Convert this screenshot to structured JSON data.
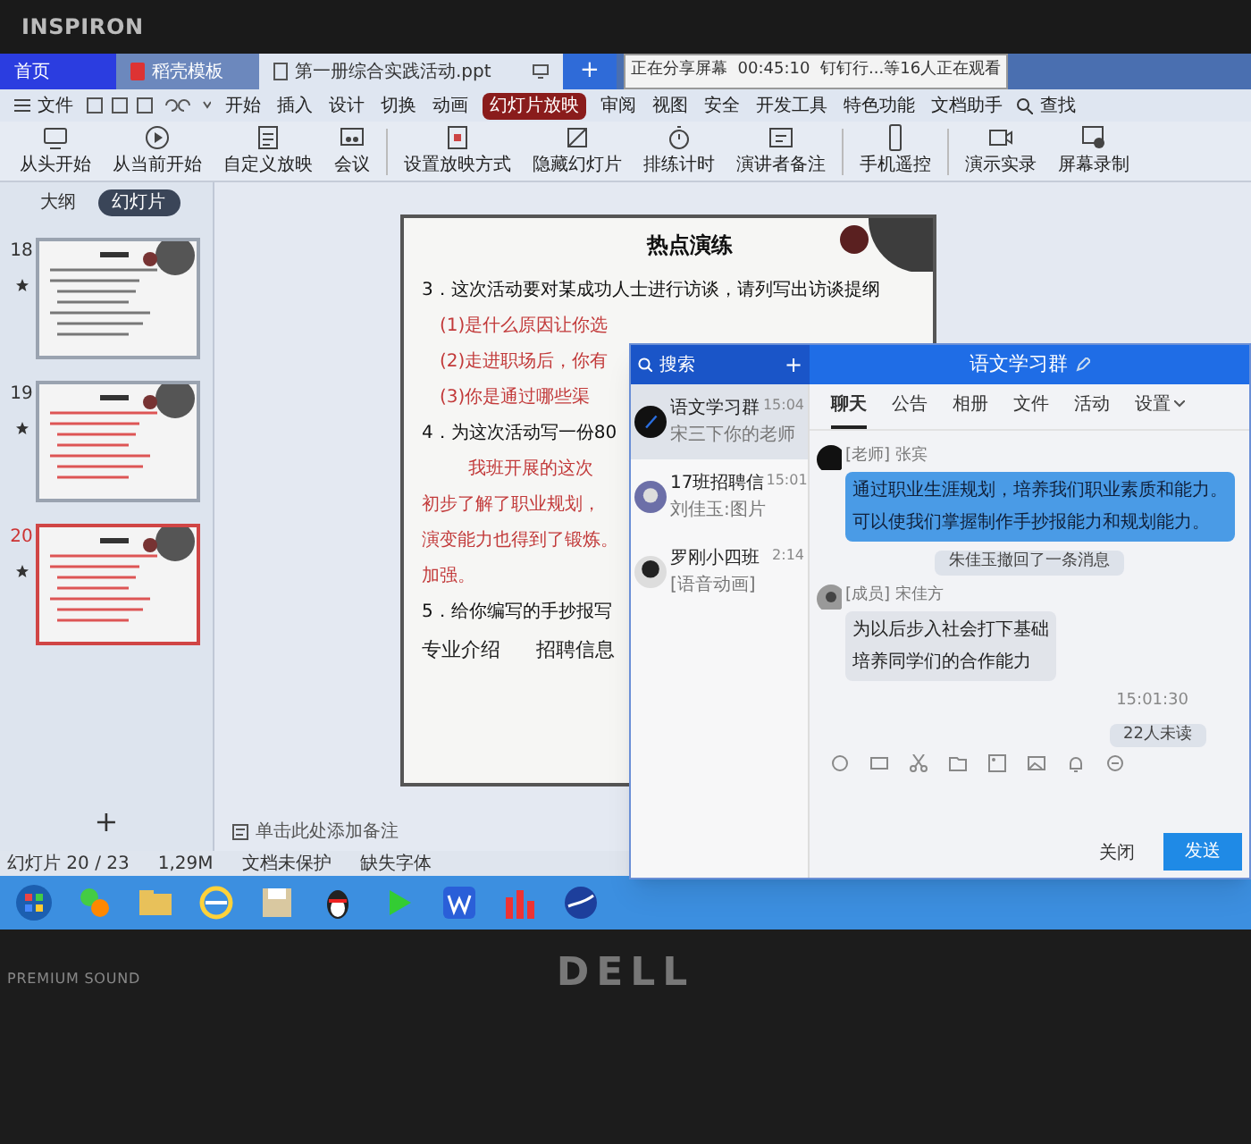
{
  "bezel": {
    "brand": "INSPIRON",
    "sound_label": "PREMIUM SOUND",
    "logo": "DELL"
  },
  "tabs": [
    {
      "label": "首页",
      "kind": "home",
      "selected": false
    },
    {
      "label": "稻壳模板",
      "kind": "template",
      "selected": false
    },
    {
      "label": "第一册综合实践活动.ppt",
      "kind": "doc",
      "selected": true
    }
  ],
  "new_tab": "+",
  "share_bar": {
    "status": "正在分享屏幕",
    "timer": "00:45:10",
    "viewers": "钉钉行...等16人正在观看"
  },
  "menu": {
    "file": "文件",
    "search": "查找",
    "items": [
      {
        "label": "开始",
        "selected": false
      },
      {
        "label": "插入",
        "selected": false
      },
      {
        "label": "设计",
        "selected": false
      },
      {
        "label": "切换",
        "selected": false
      },
      {
        "label": "动画",
        "selected": false
      },
      {
        "label": "幻灯片放映",
        "selected": true
      },
      {
        "label": "审阅",
        "selected": false
      },
      {
        "label": "视图",
        "selected": false
      },
      {
        "label": "安全",
        "selected": false
      },
      {
        "label": "开发工具",
        "selected": false
      },
      {
        "label": "特色功能",
        "selected": false
      },
      {
        "label": "文档助手",
        "selected": false
      }
    ]
  },
  "ribbon": [
    {
      "label": "从头开始",
      "kind": "monitor"
    },
    {
      "label": "从当前开始",
      "kind": "play"
    },
    {
      "label": "自定义放映",
      "kind": "list"
    },
    {
      "label": "会议",
      "kind": "meeting"
    },
    {
      "label": "设置放映方式",
      "kind": "settings"
    },
    {
      "label": "隐藏幻灯片",
      "kind": "hide"
    },
    {
      "label": "排练计时",
      "kind": "timer"
    },
    {
      "label": "演讲者备注",
      "kind": "notes"
    },
    {
      "label": "手机遥控",
      "kind": "phone"
    },
    {
      "label": "演示实录",
      "kind": "camera"
    },
    {
      "label": "屏幕录制",
      "kind": "record"
    }
  ],
  "side_tabs": [
    {
      "label": "大纲",
      "selected": false
    },
    {
      "label": "幻灯片",
      "selected": true
    }
  ],
  "thumbnails": [
    {
      "number": "18",
      "selected": false
    },
    {
      "number": "19",
      "selected": false
    },
    {
      "number": "20",
      "selected": true
    }
  ],
  "add_slide": "+",
  "notes_placeholder": "单击此处添加备注",
  "slide": {
    "title": "热点演练",
    "lines": [
      {
        "kind": "item",
        "text": "3．这次活动要对某成功人士进行访谈，请列写出访谈提纲"
      },
      {
        "kind": "answer",
        "text": "(1)是什么原因让你选"
      },
      {
        "kind": "answer",
        "text": "(2)走进职场后，你有"
      },
      {
        "kind": "answer",
        "text": "(3)你是通过哪些渠"
      },
      {
        "kind": "item",
        "text": "4．为这次活动写一份80"
      },
      {
        "kind": "answer_indent",
        "text": "我班开展的这次"
      },
      {
        "kind": "answer",
        "text": "初步了解了职业规划，"
      },
      {
        "kind": "answer",
        "text": "演变能力也得到了锻炼。"
      },
      {
        "kind": "answer",
        "text": "加强。"
      },
      {
        "kind": "item",
        "text": "5．给你编写的手抄报写"
      }
    ],
    "options": [
      "专业介绍",
      "招聘信息"
    ]
  },
  "status_bar": [
    "幻灯片 20 / 23",
    "1,29M",
    "文档未保护",
    "缺失字体"
  ],
  "chat": {
    "search": {
      "placeholder": "搜索"
    },
    "add": "+",
    "title": "语文学习群",
    "conversations": [
      {
        "name": "语文学习群",
        "time": "15:04",
        "preview": "宋三下你的老师",
        "selected": true
      },
      {
        "name": "17班招聘信",
        "time": "15:01",
        "preview": "刘佳玉:图片",
        "selected": false
      },
      {
        "name": "罗刚小四班",
        "time": "2:14",
        "preview": "[语音动画]",
        "selected": false
      }
    ],
    "tabs": [
      {
        "label": "聊天",
        "selected": true
      },
      {
        "label": "公告",
        "selected": false
      },
      {
        "label": "相册",
        "selected": false
      },
      {
        "label": "文件",
        "selected": false
      },
      {
        "label": "活动",
        "selected": false
      },
      {
        "label": "设置",
        "selected": false
      }
    ],
    "messages": [
      {
        "kind": "highlighted_message",
        "sender": "[老师] 张宾",
        "lines": [
          "通过职业生涯规划，培养我们职业素质和能力。",
          "可以使我们掌握制作手抄报能力和规划能力。"
        ]
      },
      {
        "kind": "notice",
        "text": "朱佳玉撤回了一条消息"
      },
      {
        "kind": "message",
        "sender": "[成员] 宋佳方",
        "lines": [
          "为以后步入社会打下基础",
          "培养同学们的合作能力"
        ]
      },
      {
        "kind": "time",
        "text": "15:01:30"
      },
      {
        "kind": "notice",
        "text": "22人未读"
      }
    ],
    "close": "关闭",
    "send": "发送"
  }
}
